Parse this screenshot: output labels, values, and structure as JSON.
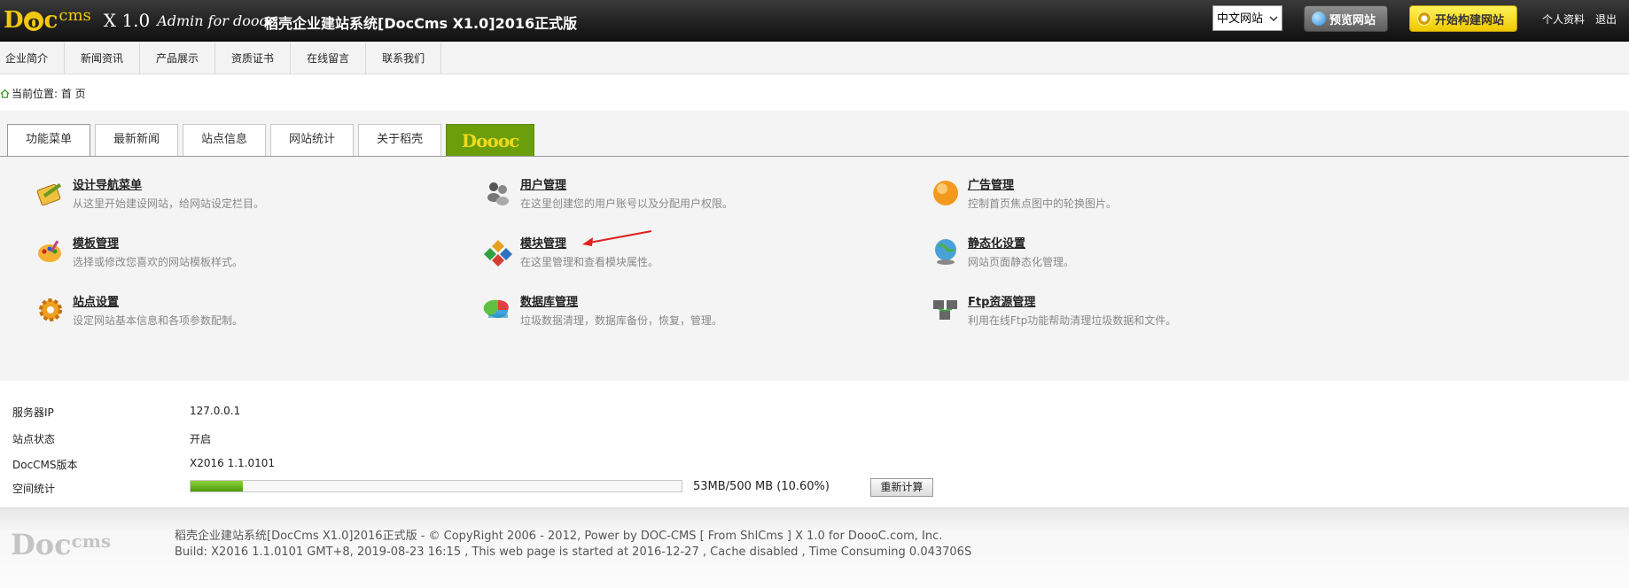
{
  "header": {
    "logo": "DocCms",
    "logo_doc": "Doc",
    "logo_cms": "cms",
    "version": "X 1.0",
    "admin_tag": "Admin for doooc",
    "system_title": "稻壳企业建站系统[DocCms X1.0]2016正式版",
    "lang_select": "中文网站",
    "preview_label": "预览网站",
    "build_label": "开始构建网站",
    "profile_label": "个人资料",
    "logout_label": "退出"
  },
  "nav": {
    "items": [
      "企业简介",
      "新闻资讯",
      "产品展示",
      "资质证书",
      "在线留言",
      "联系我们"
    ]
  },
  "breadcrumb": {
    "text": "当前位置: 首 页"
  },
  "tabs": {
    "items": [
      "功能菜单",
      "最新新闻",
      "站点信息",
      "网站统计",
      "关于稻壳"
    ],
    "brand": "Doooc"
  },
  "menu": {
    "items": [
      {
        "title": "设计导航菜单",
        "desc": "从这里开始建设网站，给网站设定栏目。",
        "icon": "notebook-pencil-icon"
      },
      {
        "title": "用户管理",
        "desc": "在这里创建您的用户账号以及分配用户权限。",
        "icon": "users-icon"
      },
      {
        "title": "广告管理",
        "desc": "控制首页焦点图中的轮换图片。",
        "icon": "orange-ball-icon"
      },
      {
        "title": "模板管理",
        "desc": "选择或修改您喜欢的网站模板样式。",
        "icon": "palette-icon"
      },
      {
        "title": "模块管理",
        "desc": "在这里管理和查看模块属性。",
        "icon": "modules-icon"
      },
      {
        "title": "静态化设置",
        "desc": "网站页面静态化管理。",
        "icon": "globe-icon"
      },
      {
        "title": "站点设置",
        "desc": "设定网站基本信息和各项参数配制。",
        "icon": "gear-icon"
      },
      {
        "title": "数据库管理",
        "desc": "垃圾数据清理，数据库备份，恢复，管理。",
        "icon": "database-icon"
      },
      {
        "title": "Ftp资源管理",
        "desc": "利用在线Ftp功能帮助清理垃圾数据和文件。",
        "icon": "ftp-icon"
      }
    ]
  },
  "info": {
    "server_ip_label": "服务器IP",
    "server_ip": "127.0.0.1",
    "status_label": "站点状态",
    "status": "开启",
    "version_label": "DocCMS版本",
    "version": "X2016 1.1.0101",
    "space_label": "空间统计",
    "space_text": "53MB/500 MB (10.60%)",
    "space_fraction": 0.106,
    "recalc_label": "重新计算"
  },
  "footer": {
    "line1": "稻壳企业建站系统[DocCms X1.0]2016正式版 - © CopyRight 2006 - 2012, Power by DOC-CMS [ From ShlCms ] X 1.0 for DoooC.com, Inc.",
    "line2": "Build: X2016 1.1.0101 GMT+8, 2019-08-23 16:15 , This web page is started at 2016-12-27 , Cache disabled , Time Consuming 0.043706S"
  },
  "colors": {
    "header_bg": "#1f1f1f",
    "accent_yellow": "#f2c812",
    "brand_green": "#6b9e0a",
    "progress_green": "#4c9a0c",
    "annotation_red": "#e02020"
  }
}
